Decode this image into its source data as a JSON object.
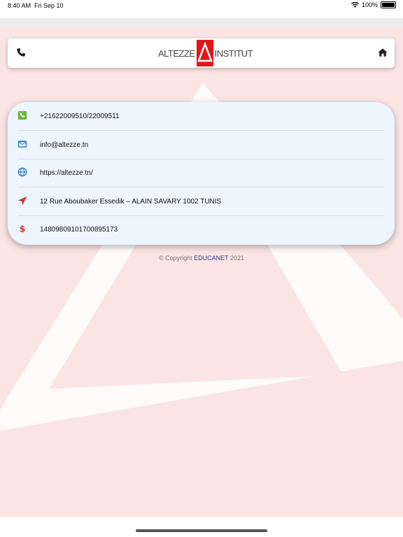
{
  "status_bar": {
    "time": "8:40 AM",
    "date": "Fri Sep 10",
    "battery_text": "100%",
    "icons": [
      "wifi-icon",
      "battery-icon"
    ]
  },
  "header": {
    "logo_left": "ALTEZZE",
    "logo_right": "INSTITUT",
    "icons": [
      "phone-icon",
      "home-icon"
    ]
  },
  "contact": {
    "items": [
      {
        "icon": "phone-square-icon",
        "color": "#6db33f",
        "text": "+21622009510/22009511"
      },
      {
        "icon": "envelope-icon",
        "color": "#2f80d8",
        "text": "info@altezze.tn"
      },
      {
        "icon": "globe-icon",
        "color": "#2f80d8",
        "text": "https://altezze.tn/"
      },
      {
        "icon": "location-arrow-icon",
        "color": "#d42f2f",
        "text": "12 Rue Aboubaker Essedik – ALAIN SAVARY 1002 TUNIS"
      },
      {
        "icon": "dollar-icon",
        "color": "#d42f2f",
        "text": "1480980910170089517 3"
      }
    ]
  },
  "footer": {
    "prefix": "© Copyright",
    "brand": "EDUCANET",
    "year": "2021"
  },
  "colors": {
    "background": "#fbe4e4",
    "card": "#edf5fe",
    "logo_red": "#e3151a",
    "brand_blue": "#2b3a8c"
  }
}
